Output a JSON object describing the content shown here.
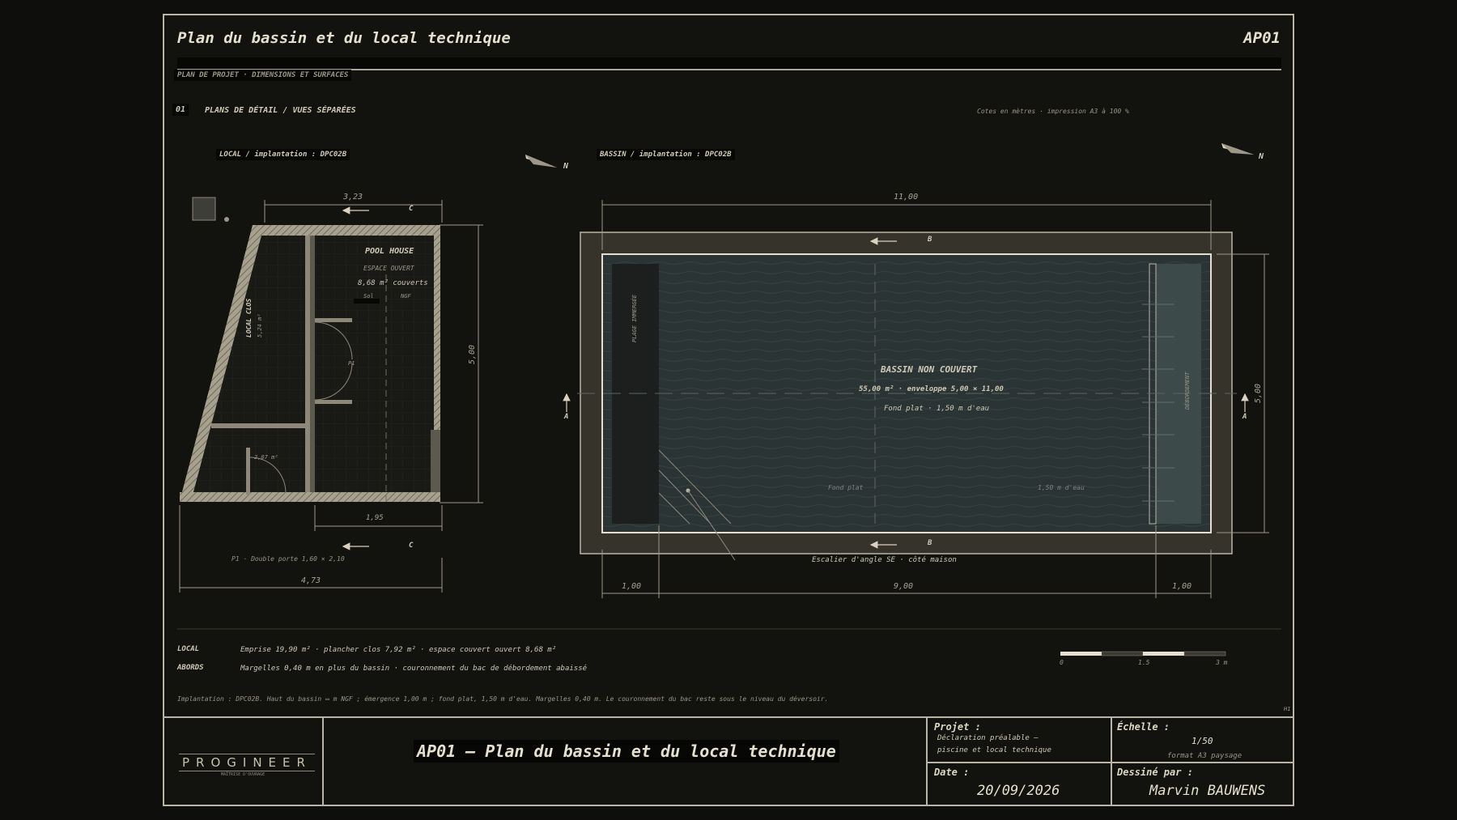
{
  "sheet": {
    "title": "Plan du bassin et du local technique",
    "code": "AP01",
    "subtitle": "PLAN DE PROJET · DIMENSIONS ET SURFACES",
    "section_number": "01",
    "section_title": "PLANS DE DÉTAIL / VUES SÉPARÉES",
    "print_note": "Cotes en mètres · impression A3 à 100 %"
  },
  "local_plan": {
    "label": "LOCAL / implantation : DPC02B",
    "north": "N",
    "section_mark": "C",
    "room_title": "POOL HOUSE",
    "room_sub": "ESPACE OUVERT",
    "room_area": "8,68 m² couverts",
    "floor_label": "Sol",
    "floor_ngf": "NGF",
    "closed_label": "LOCAL CLOS",
    "closed_area": "5,24 m²",
    "door_tag": "P1",
    "small_area": "2,07 m²",
    "door_note": "P1 · Double porte 1,60 × 2,10",
    "dim_top": "3,23",
    "dim_right": "5,00",
    "dim_inner": "1,95",
    "dim_bottom": "4,73"
  },
  "pool_plan": {
    "label": "BASSIN / implantation : DPC02B",
    "north": "N",
    "section_b": "B",
    "section_a": "A",
    "title": "BASSIN NON COUVERT",
    "area": "55,00 m² · enveloppe 5,00 × 11,00",
    "depth": "Fond plat · 1,50 m d'eau",
    "beach": "PLAGE IMMERGÉE",
    "overflow": "DÉBORDEMENT",
    "fond_plat": "Fond plat",
    "depth_mark": "1,50 m d'eau",
    "stair_note": "Escalier d'angle SE · côté maison",
    "dim_top": "11,00",
    "dim_right": "5,00",
    "dim_left_seg": "1,00",
    "dim_mid_seg": "9,00",
    "dim_right_seg": "1,00"
  },
  "notes": {
    "local_key": "LOCAL",
    "local_text": "Emprise 19,90 m² · plancher clos 7,92 m² · espace couvert ouvert 8,68 m²",
    "abords_key": "ABORDS",
    "abords_text": "Margelles 0,40 m en plus du bassin · couronnement du bac de débordement abaissé",
    "implantation": "Implantation : DPC02B. Haut du bassin ▭     m NGF ; émergence 1,00 m ; fond plat, 1,50 m d'eau. Margelles 0,40 m. Le couronnement du bac reste sous le niveau du déversoir.",
    "scale_0": "0",
    "scale_mid": "1.5",
    "scale_end": "3 m",
    "corner_mark": "H1"
  },
  "title_block": {
    "logo": "PROGINEER",
    "logo_sub": "MAÎTRISE D'OUVRAGE",
    "main_title": "AP01 – Plan du bassin et du local technique",
    "projet_label": "Projet :",
    "projet_line1": "Déclaration préalable –",
    "projet_line2": "piscine et local technique",
    "echelle_label": "Échelle :",
    "echelle_value": "1/50",
    "echelle_format": "format A3 paysage",
    "date_label": "Date :",
    "date_value": "20/09/2026",
    "dessine_label": "Dessiné par :",
    "dessine_value": "Marvin BAUWENS"
  },
  "colors": {
    "background": "#0e0f0c",
    "sheet": "#12130f",
    "line": "#b9b4a6",
    "wall": "#bdb6a3",
    "pool_water": "#2b3434",
    "pool_surround": "#36332a",
    "overflow": "#3c4a4a"
  }
}
